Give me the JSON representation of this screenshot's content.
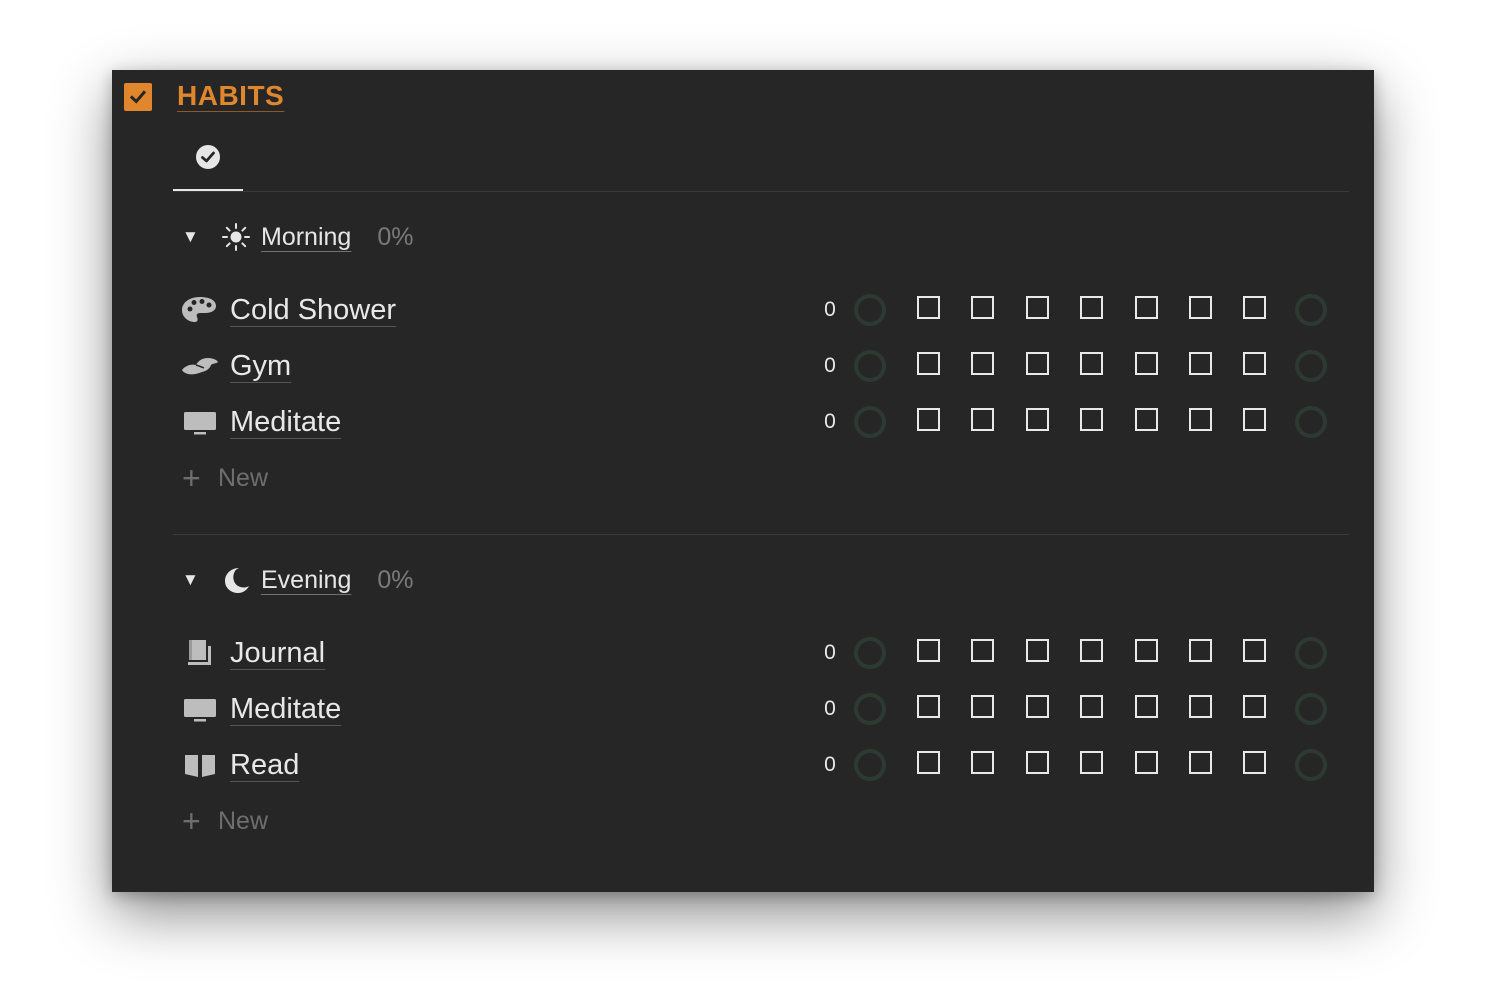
{
  "title": "HABITS",
  "colors": {
    "accent": "#e0872d",
    "background": "#262626",
    "text": "#e8e8e8",
    "muted": "#7a7a7a",
    "ring": "#2d3a31"
  },
  "tab": {
    "icon": "check-circle-icon"
  },
  "groups": [
    {
      "title": "Morning",
      "percent": "0%",
      "icon": "sun-icon",
      "items": [
        {
          "name": "Cold Shower",
          "icon": "palette-icon",
          "count": "0",
          "days_checked": [
            false,
            false,
            false,
            false,
            false,
            false,
            false
          ]
        },
        {
          "name": "Gym",
          "icon": "bicep-icon",
          "count": "0",
          "days_checked": [
            false,
            false,
            false,
            false,
            false,
            false,
            false
          ]
        },
        {
          "name": "Meditate",
          "icon": "monitor-icon",
          "count": "0",
          "days_checked": [
            false,
            false,
            false,
            false,
            false,
            false,
            false
          ]
        }
      ],
      "new_label": "New"
    },
    {
      "title": "Evening",
      "percent": "0%",
      "icon": "moon-icon",
      "items": [
        {
          "name": "Journal",
          "icon": "notebook-icon",
          "count": "0",
          "days_checked": [
            false,
            false,
            false,
            false,
            false,
            false,
            false
          ]
        },
        {
          "name": "Meditate",
          "icon": "monitor-icon",
          "count": "0",
          "days_checked": [
            false,
            false,
            false,
            false,
            false,
            false,
            false
          ]
        },
        {
          "name": "Read",
          "icon": "open-book-icon",
          "count": "0",
          "days_checked": [
            false,
            false,
            false,
            false,
            false,
            false,
            false
          ]
        }
      ],
      "new_label": "New"
    }
  ]
}
